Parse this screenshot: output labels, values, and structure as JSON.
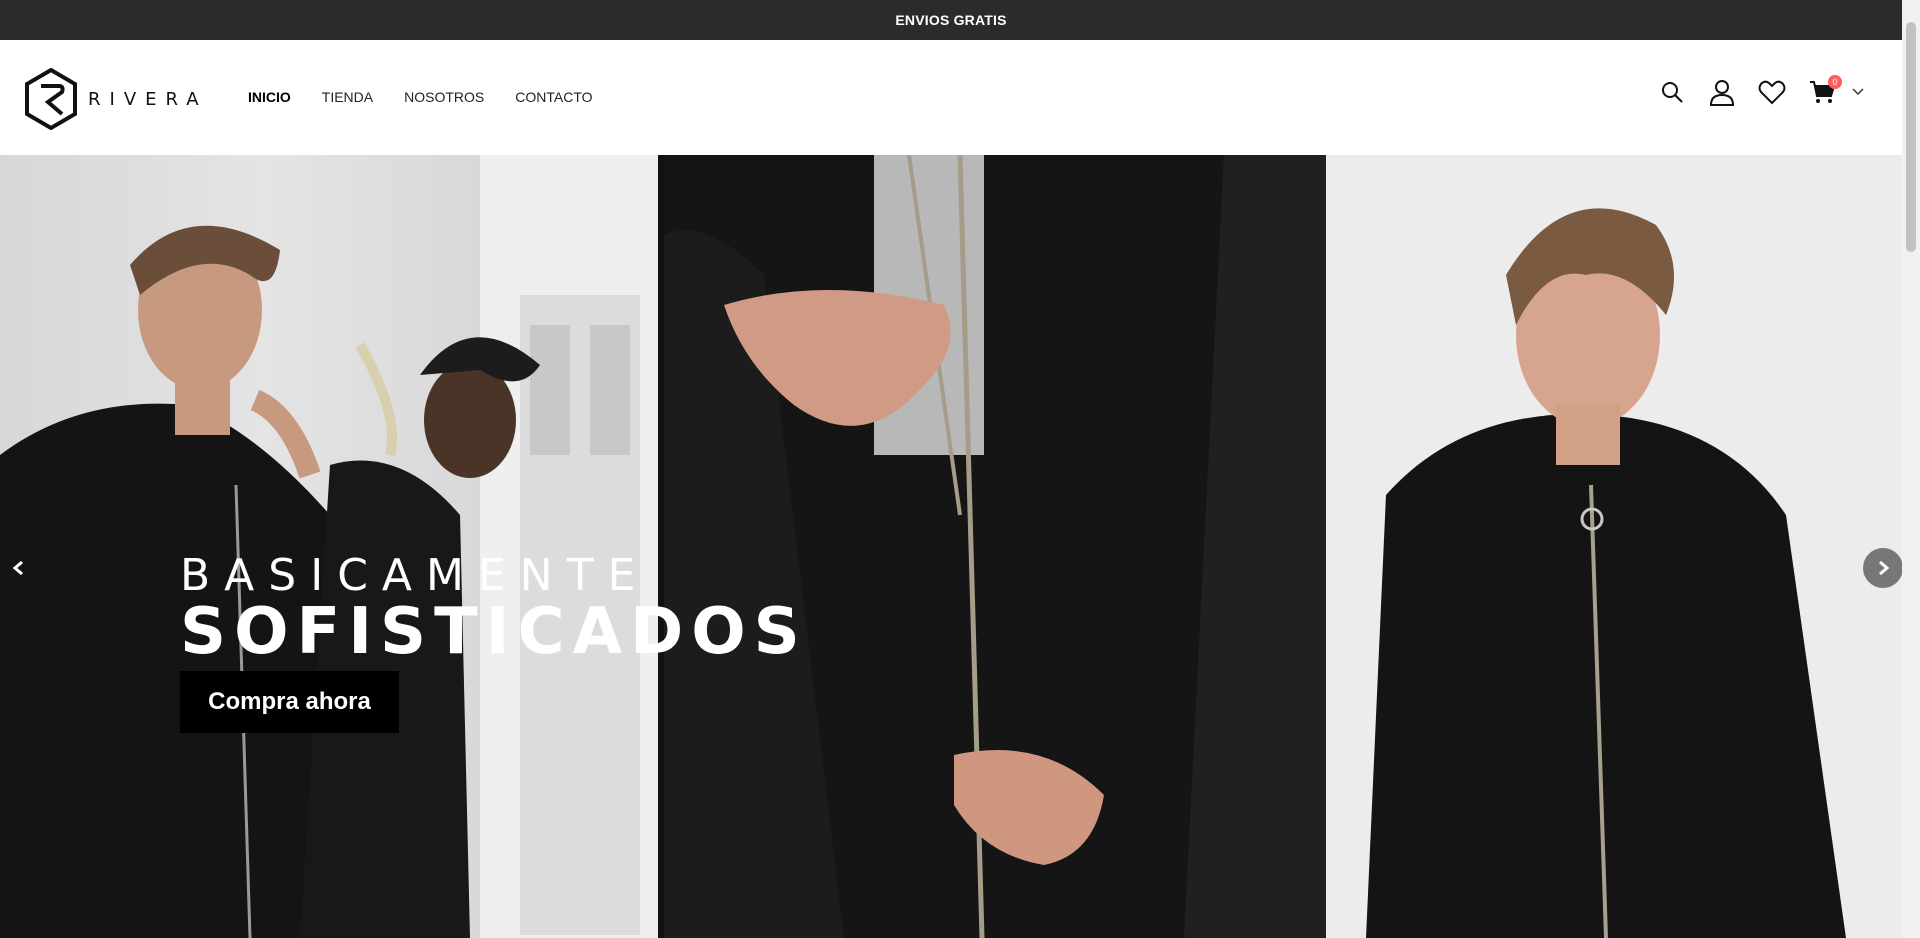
{
  "announcement": "ENVIOS GRATIS",
  "brand": {
    "name": "RIVERA",
    "logo_icon": "hexagon-r-logo"
  },
  "nav": {
    "items": [
      {
        "label": "INICIO",
        "active": true
      },
      {
        "label": "TIENDA",
        "active": false
      },
      {
        "label": "NOSOTROS",
        "active": false
      },
      {
        "label": "CONTACTO",
        "active": false
      }
    ]
  },
  "header_icons": {
    "search": "search-icon",
    "account": "user-icon",
    "wishlist": "heart-icon",
    "cart": "cart-icon",
    "cart_count": "0"
  },
  "hero": {
    "subtitle": "BASICAMENTE",
    "title": "SOFISTICADOS",
    "cta_label": "Compra ahora",
    "prev_icon": "chevron-left-icon",
    "next_icon": "chevron-right-icon"
  },
  "colors": {
    "topbar_bg": "#2b2b2b",
    "badge": "#ff5a5f",
    "cta_bg": "#000000"
  }
}
